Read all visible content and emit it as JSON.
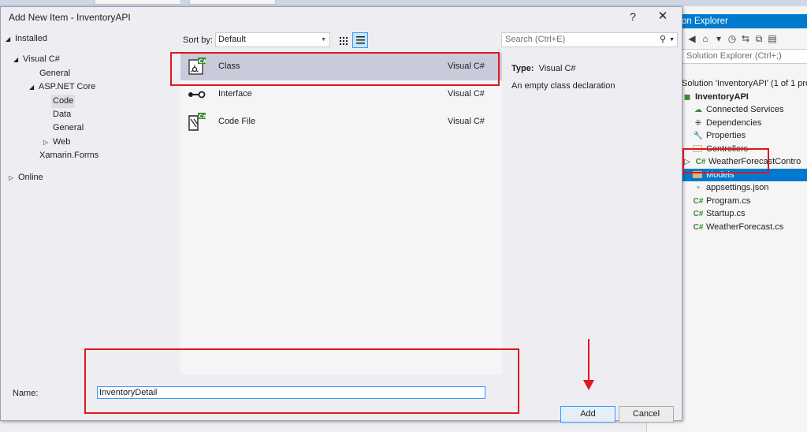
{
  "dialog": {
    "title": "Add New Item - InventoryAPI",
    "help_label": "?",
    "close_label": "✕"
  },
  "tree": {
    "installed": "Installed",
    "visual_csharp": "Visual C#",
    "general": "General",
    "aspnet_core": "ASP.NET Core",
    "code": "Code",
    "data": "Data",
    "general2": "General",
    "web": "Web",
    "xamarin": "Xamarin.Forms",
    "online": "Online"
  },
  "sort": {
    "label": "Sort by:",
    "value": "Default"
  },
  "search": {
    "placeholder": "Search (Ctrl+E)"
  },
  "templates": [
    {
      "name": "Class",
      "lang": "Visual C#",
      "icon": "class-icon"
    },
    {
      "name": "Interface",
      "lang": "Visual C#",
      "icon": "interface-icon"
    },
    {
      "name": "Code File",
      "lang": "Visual C#",
      "icon": "code-file-icon"
    }
  ],
  "description": {
    "type_label": "Type:",
    "type_value": "Visual C#",
    "text": "An empty class declaration"
  },
  "name_field": {
    "label": "Name:",
    "value": "InventoryDetail"
  },
  "buttons": {
    "add": "Add",
    "cancel": "Cancel"
  },
  "solution_explorer": {
    "title": "on Explorer",
    "search": "Solution Explorer (Ctrl+;)",
    "solution": "Solution 'InventoryAPI' (1 of 1 pro",
    "project": "InventoryAPI",
    "items": {
      "connected": "Connected Services",
      "dependencies": "Dependencies",
      "properties": "Properties",
      "controllers": "Controllers",
      "weather_controller": "WeatherForecastContro",
      "models": "Models",
      "appsettings": "appsettings.json",
      "program": "Program.cs",
      "startup": "Startup.cs",
      "weatherforecast": "WeatherForecast.cs"
    }
  },
  "colors": {
    "accent": "#007acc",
    "annotation": "#e0161b",
    "selection": "#c9cbdb"
  }
}
